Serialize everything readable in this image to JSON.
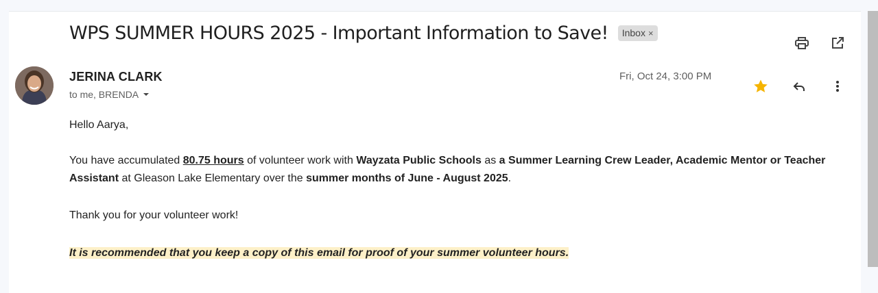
{
  "email": {
    "subject": "WPS SUMMER HOURS 2025 - Important Information to Save!",
    "label": "Inbox",
    "label_remove": "×",
    "sender": "JERINA CLARK",
    "recipients": "to me, BRENDA",
    "date": "Fri, Oct 24, 3:00 PM",
    "starred": true,
    "greeting": "Hello Aarya,",
    "para1": {
      "t1": "You have accumulated ",
      "hours": "80.75 hours",
      "t2": " of volunteer work with ",
      "org": "Wayzata Public Schools",
      "t3": " as ",
      "role": "a Summer Learning Crew Leader, Academic Mentor or Teacher Assistant",
      "t4": " at Gleason Lake Elementary over the ",
      "period": "summer months of June - August 2025",
      "t5": "."
    },
    "para2": "Thank you for your volunteer work!",
    "note": "It is recommended that you keep a copy of this email for proof of your summer volunteer hours."
  },
  "icons": {
    "print": "print-icon",
    "open_new_window": "open-in-new-window-icon",
    "star": "star-icon",
    "reply": "reply-icon",
    "more": "more-vertical-icon",
    "dropdown": "chevron-down-icon"
  },
  "colors": {
    "star": "#f5b400",
    "highlight": "#fdf0c8",
    "chip_bg": "#dddddd"
  }
}
